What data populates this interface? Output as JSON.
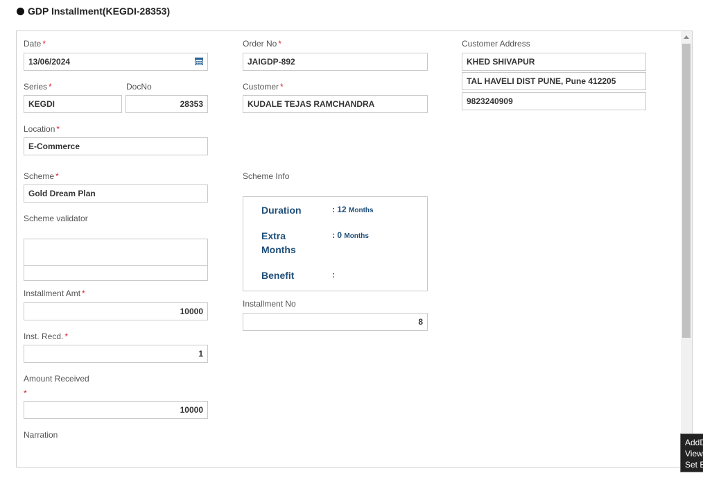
{
  "title": "GDP Installment(KEGDI-28353)",
  "colors": {
    "required": "#d9232d",
    "accent": "#1f4e79"
  },
  "form": {
    "date": {
      "label": "Date",
      "required": "*",
      "value": "13/06/2024",
      "icon": "calendar-icon"
    },
    "order_no": {
      "label": "Order No",
      "required": "*",
      "value": "JAIGDP-892"
    },
    "customer_address": {
      "label": "Customer Address",
      "line1": "KHED SHIVAPUR",
      "line2": "TAL HAVELI DIST PUNE, Pune 412205",
      "phone": "9823240909"
    },
    "series": {
      "label": "Series",
      "required": "*",
      "value": "KEGDI"
    },
    "doc_no": {
      "label": "DocNo",
      "value": "28353"
    },
    "customer": {
      "label": "Customer",
      "required": "*",
      "value": "KUDALE TEJAS RAMCHANDRA"
    },
    "location": {
      "label": "Location",
      "required": "*",
      "value": "E-Commerce"
    },
    "scheme": {
      "label": "Scheme",
      "required": "*",
      "value": "Gold Dream Plan"
    },
    "scheme_info": {
      "label": "Scheme Info",
      "duration_key": "Duration",
      "duration_value": ": 12",
      "duration_unit": "Months",
      "extra_key_line1": "Extra",
      "extra_key_line2": "Months",
      "extra_value": ": 0",
      "extra_unit": "Months",
      "benefit_key": "Benefit",
      "benefit_value": ":"
    },
    "scheme_validator": {
      "label": "Scheme validator"
    },
    "installment_amt": {
      "label": "Installment Amt",
      "required": "*",
      "value": "10000"
    },
    "installment_no": {
      "label": "Installment No",
      "value": "8"
    },
    "inst_recd": {
      "label": "Inst. Recd.",
      "required": "*",
      "value": "1"
    },
    "amount_received": {
      "label": "Amount Received",
      "required": "*",
      "value": "10000"
    },
    "narration": {
      "label": "Narration"
    }
  },
  "tooltip": {
    "line1": "AddD",
    "line2": "View",
    "line3": "Set B"
  }
}
